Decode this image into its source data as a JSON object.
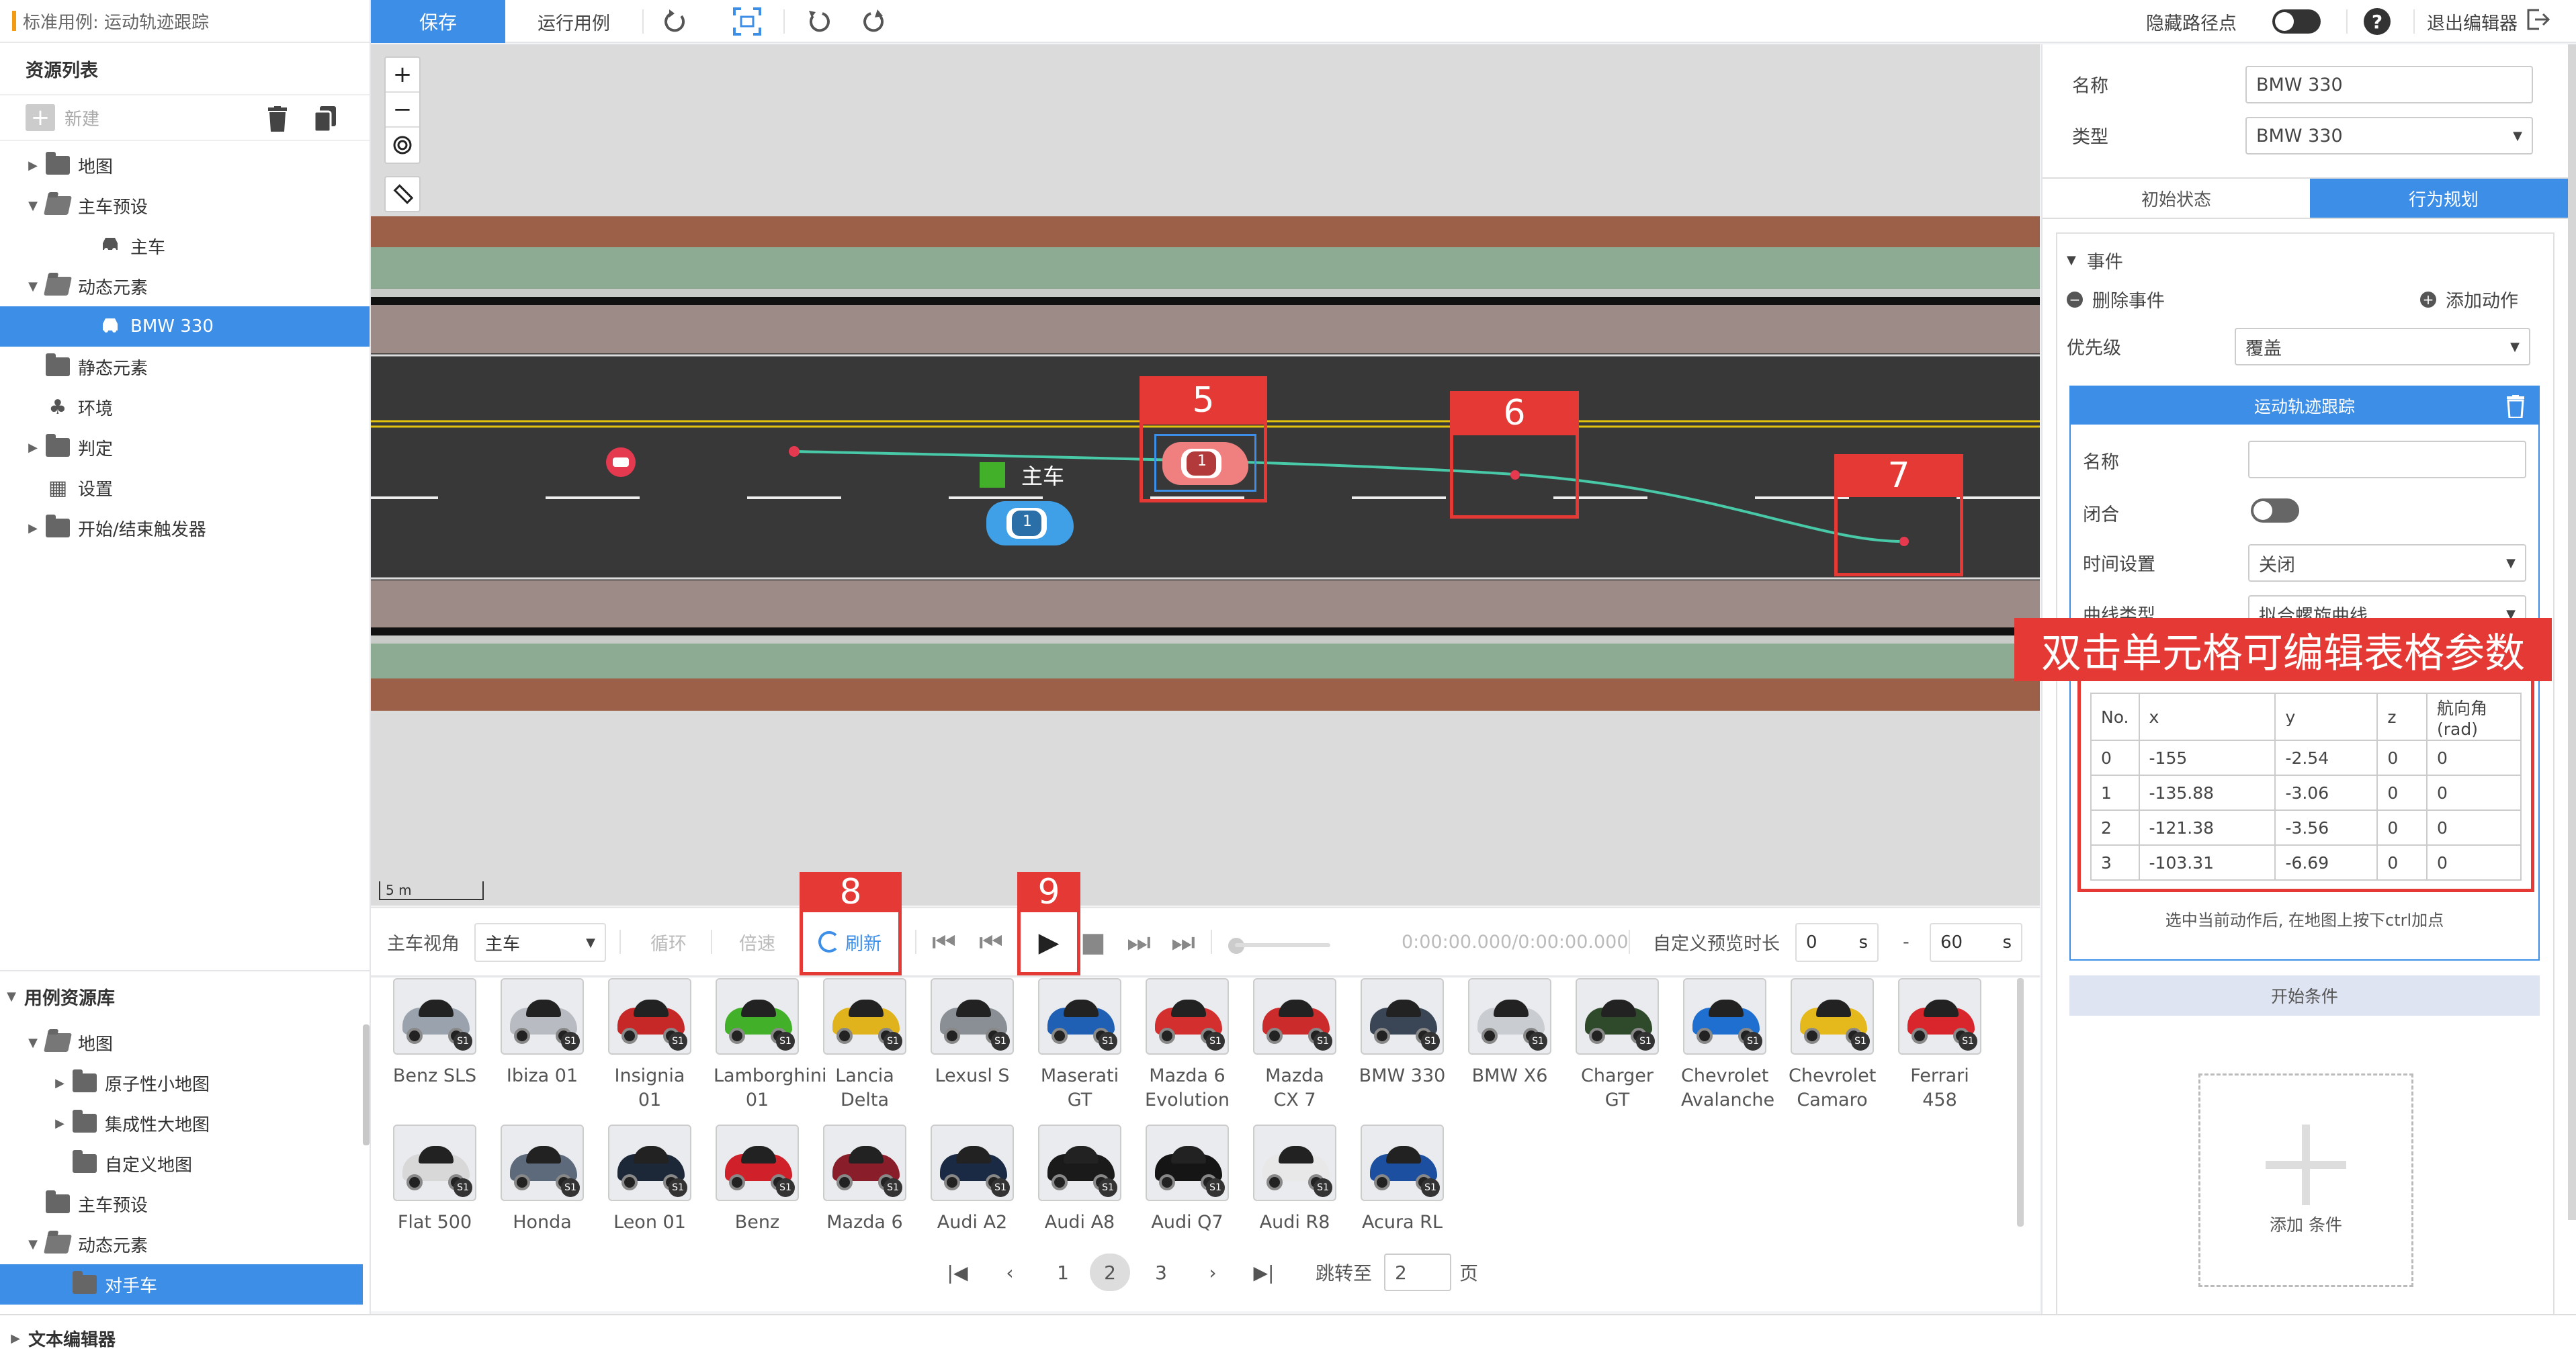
{
  "window": {
    "title": "标准用例: 运动轨迹跟踪"
  },
  "toolbar": {
    "save": "保存",
    "run": "运行用例",
    "hide_waypoints": "隐藏路径点",
    "exit_editor": "退出编辑器"
  },
  "resources": {
    "header": "资源列表",
    "new_label": "新建",
    "items": [
      {
        "label": "地图",
        "caret": "▶",
        "kind": "folder"
      },
      {
        "label": "主车预设",
        "caret": "▼",
        "kind": "folder-open"
      },
      {
        "label": "主车",
        "caret": "",
        "kind": "car"
      },
      {
        "label": "动态元素",
        "caret": "▼",
        "kind": "folder-open"
      },
      {
        "label": "BMW 330",
        "caret": "",
        "kind": "car",
        "selected": true
      },
      {
        "label": "静态元素",
        "caret": "",
        "kind": "folder"
      },
      {
        "label": "环境",
        "caret": "",
        "kind": "tree"
      },
      {
        "label": "判定",
        "caret": "▶",
        "kind": "folder"
      },
      {
        "label": "设置",
        "caret": "",
        "kind": "settings"
      },
      {
        "label": "开始/结束触发器",
        "caret": "▶",
        "kind": "folder"
      }
    ]
  },
  "library": {
    "header": "用例资源库",
    "items": [
      {
        "label": "地图",
        "caret": "▼",
        "kind": "folder-open",
        "indent": 1
      },
      {
        "label": "原子性小地图",
        "caret": "▶",
        "kind": "folder",
        "indent": 2
      },
      {
        "label": "集成性大地图",
        "caret": "▶",
        "kind": "folder",
        "indent": 2
      },
      {
        "label": "自定义地图",
        "caret": "",
        "kind": "folder",
        "indent": 2
      },
      {
        "label": "主车预设",
        "caret": "",
        "kind": "folder",
        "indent": 1
      },
      {
        "label": "动态元素",
        "caret": "▼",
        "kind": "folder-open",
        "indent": 1
      },
      {
        "label": "对手车",
        "caret": "",
        "kind": "folder",
        "indent": 2,
        "selected": true
      }
    ]
  },
  "bottom_panel": {
    "label": "文本编辑器"
  },
  "map": {
    "scale_label": "5 m",
    "ego_label": "主车",
    "car_badge": "1",
    "annotations": [
      "5",
      "6",
      "7"
    ]
  },
  "controls": {
    "view_label": "主车视角",
    "view_value": "主车",
    "loop": "循环",
    "speed": "倍速",
    "refresh": "刷新",
    "time": "0:00:00.000/0:00:00.000",
    "custom_duration": "自定义预览时长",
    "start_value": "0",
    "end_value": "60",
    "unit": "s",
    "dash": "-",
    "annotations": [
      "8",
      "9"
    ]
  },
  "cars": [
    {
      "name": "Benz SLS",
      "color": "#9aa3ad"
    },
    {
      "name": "Ibiza 01",
      "color": "#b8bcc2"
    },
    {
      "name": "Insignia 01",
      "color": "#c62828"
    },
    {
      "name": "Lamborghini 01",
      "color": "#43b02a"
    },
    {
      "name": "Lancia Delta",
      "color": "#e0b21b"
    },
    {
      "name": "Lexusl S",
      "color": "#8a8f96"
    },
    {
      "name": "Maserati GT",
      "color": "#1f5fb4"
    },
    {
      "name": "Mazda 6 Evolution",
      "color": "#d32f2f"
    },
    {
      "name": "Mazda CX 7",
      "color": "#cc2b2b"
    },
    {
      "name": "BMW 330",
      "color": "#3a4656"
    },
    {
      "name": "BMW X6",
      "color": "#c9ccd1"
    },
    {
      "name": "Charger GT",
      "color": "#2f4a2a"
    },
    {
      "name": "Chevrolet Avalanche",
      "color": "#1e6fd0"
    },
    {
      "name": "Chevrolet Camaro",
      "color": "#e5b81c"
    },
    {
      "name": "Ferrari 458",
      "color": "#d8262c"
    },
    {
      "name": "Flat 500",
      "color": "#d8d8d8"
    },
    {
      "name": "Honda",
      "color": "#5c6a7c"
    },
    {
      "name": "Leon 01",
      "color": "#1c2838"
    },
    {
      "name": "Benz",
      "color": "#d0202a"
    },
    {
      "name": "Mazda 6",
      "color": "#8a1d2a"
    },
    {
      "name": "Audi A2",
      "color": "#1b2a44"
    },
    {
      "name": "Audi A8",
      "color": "#1a1a1a"
    },
    {
      "name": "Audi Q7",
      "color": "#151515"
    },
    {
      "name": "Audi R8",
      "color": "#e8e8e8"
    },
    {
      "name": "Acura RL",
      "color": "#1d4fa0"
    }
  ],
  "pagination": {
    "pages": [
      "1",
      "2",
      "3"
    ],
    "current": "2",
    "jump_label": "跳转至",
    "jump_value": "2",
    "page_suffix": "页"
  },
  "props": {
    "name_label": "名称",
    "name_value": "BMW 330",
    "type_label": "类型",
    "type_value": "BMW 330",
    "tabs": [
      "初始状态",
      "行为规划"
    ],
    "event_label": "事件",
    "delete_event": "删除事件",
    "add_action": "添加动作",
    "priority_label": "优先级",
    "priority_value": "覆盖",
    "action_title": "运动轨迹跟踪",
    "action_name_label": "名称",
    "closed_label": "闭合",
    "time_label": "时间设置",
    "time_value": "关闭",
    "curve_label": "曲线类型",
    "curve_value": "拟合螺旋曲线",
    "annotation": "双击单元格可编辑表格参数",
    "table_headers": [
      "No.",
      "x",
      "y",
      "z",
      "航向角 (rad)"
    ],
    "table_rows": [
      [
        "0",
        "-155",
        "-2.54",
        "0",
        "0"
      ],
      [
        "1",
        "-135.88",
        "-3.06",
        "0",
        "0"
      ],
      [
        "2",
        "-121.38",
        "-3.56",
        "0",
        "0"
      ],
      [
        "3",
        "-103.31",
        "-6.69",
        "0",
        "0"
      ]
    ],
    "hint": "选中当前动作后, 在地图上按下ctrl加点",
    "start_condition": "开始条件",
    "add_condition": "添加 条件"
  },
  "colors": {
    "accent": "#3d8ee6",
    "annotation": "#e53935",
    "ego": "#3fa0e8",
    "npc": "#f08080",
    "trajectory": "#48c9a8"
  },
  "icons": [
    "trash-icon",
    "copy-icon",
    "redo-icon",
    "capture-icon",
    "undo-icon",
    "refresh-icon",
    "help-icon",
    "exit-icon",
    "zoom-in-icon",
    "zoom-out-icon",
    "locate-icon",
    "ruler-icon"
  ]
}
